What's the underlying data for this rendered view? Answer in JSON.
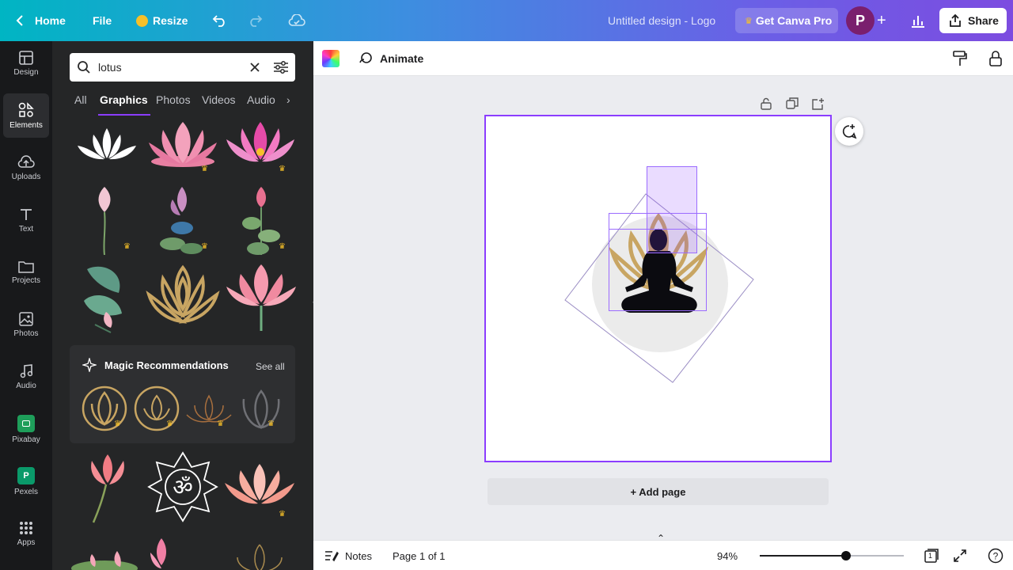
{
  "topbar": {
    "home_label": "Home",
    "file_label": "File",
    "resize_label": "Resize",
    "design_title": "Untitled design - Logo",
    "get_pro_label": "Get Canva Pro",
    "avatar_initial": "P",
    "share_label": "Share"
  },
  "rail": {
    "items": [
      {
        "label": "Design",
        "icon": "layout-icon"
      },
      {
        "label": "Elements",
        "icon": "shapes-icon"
      },
      {
        "label": "Uploads",
        "icon": "cloud-upload-icon"
      },
      {
        "label": "Text",
        "icon": "text-t-icon"
      },
      {
        "label": "Projects",
        "icon": "folder-icon"
      },
      {
        "label": "Photos",
        "icon": "image-icon"
      },
      {
        "label": "Audio",
        "icon": "music-note-icon"
      },
      {
        "label": "Pixabay",
        "icon": "pixabay-icon"
      },
      {
        "label": "Pexels",
        "icon": "pexels-icon"
      },
      {
        "label": "Apps",
        "icon": "grid-icon"
      }
    ]
  },
  "panel": {
    "search_value": "lotus",
    "tabs": [
      "All",
      "Graphics",
      "Photos",
      "Videos",
      "Audio"
    ],
    "active_tab": "Graphics",
    "magic_title": "Magic Recommendations",
    "see_all_label": "See all"
  },
  "toolbar": {
    "animate_label": "Animate"
  },
  "canvas": {
    "add_page_label": "+ Add page"
  },
  "bottombar": {
    "notes_label": "Notes",
    "page_label": "Page 1 of 1",
    "zoom_label": "94%",
    "zoom_fraction": 0.6,
    "page_count": "1"
  },
  "colors": {
    "accent": "#8b3dff",
    "panel_bg": "#252627",
    "rail_bg": "#18191b",
    "lotus_gold": "#c8a562",
    "pink": "#f08fa8"
  }
}
